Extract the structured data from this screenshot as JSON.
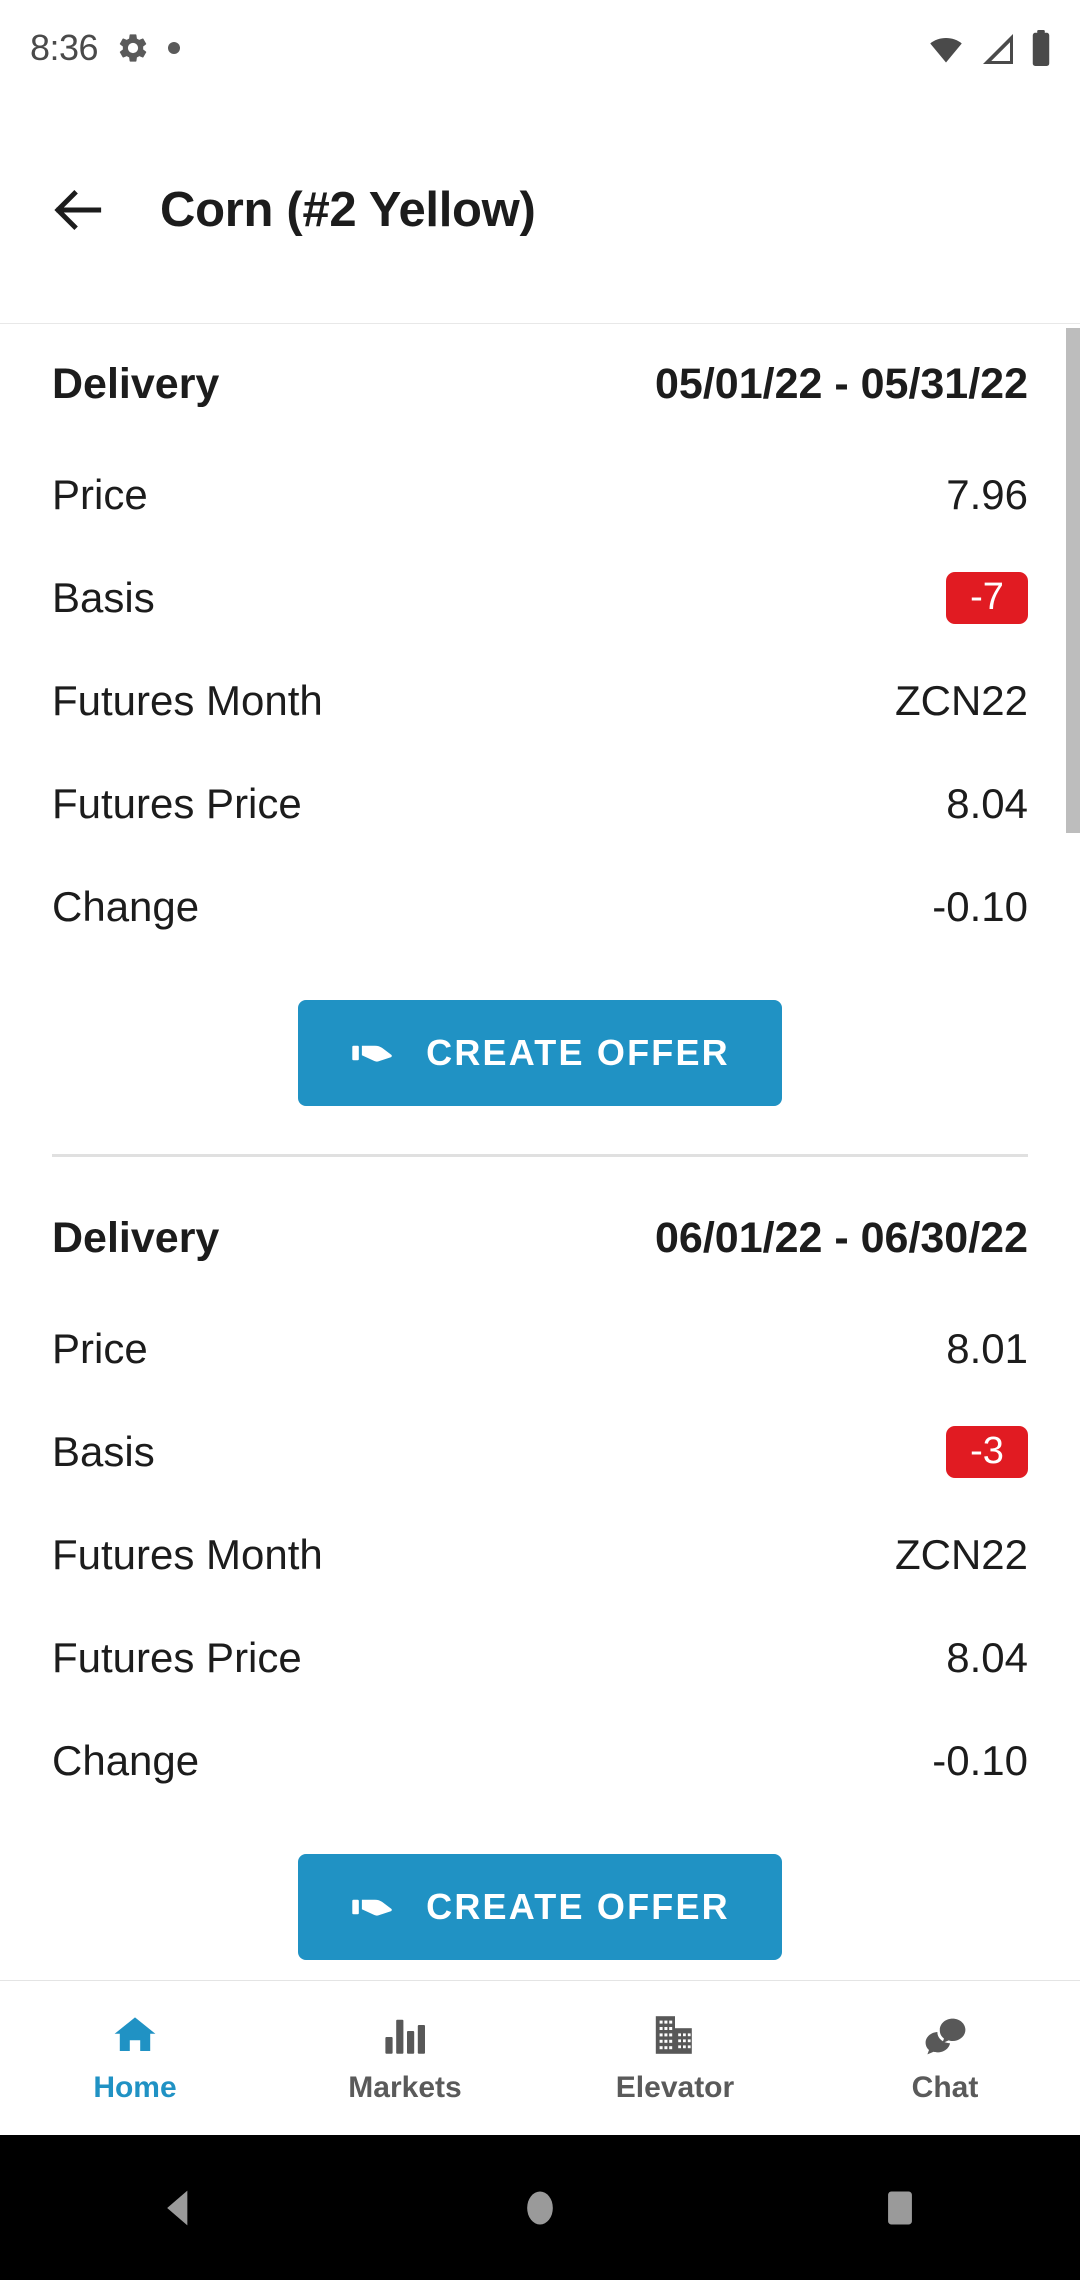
{
  "status_bar": {
    "time": "8:36",
    "icons_left": [
      "gear-icon",
      "dot-indicator"
    ],
    "icons_right": [
      "wifi-icon",
      "cellular-signal-icon",
      "battery-icon"
    ]
  },
  "app_bar": {
    "back_icon": "back-arrow-icon",
    "title": "Corn (#2 Yellow)"
  },
  "colors": {
    "accent": "#2092c4",
    "negative_badge": "#e11b22",
    "text": "#1c1c1c",
    "muted": "#5a5a5a"
  },
  "cards": [
    {
      "delivery_label": "Delivery",
      "delivery_range": "05/01/22 - 05/31/22",
      "rows": [
        {
          "label": "Price",
          "value": "7.96",
          "badge": false
        },
        {
          "label": "Basis",
          "value": "-7",
          "badge": true
        },
        {
          "label": "Futures Month",
          "value": "ZCN22",
          "badge": false
        },
        {
          "label": "Futures Price",
          "value": "8.04",
          "badge": false
        },
        {
          "label": "Change",
          "value": "-0.10",
          "badge": false
        }
      ],
      "button_label": "CREATE OFFER",
      "button_icon": "handshake-icon"
    },
    {
      "delivery_label": "Delivery",
      "delivery_range": "06/01/22 - 06/30/22",
      "rows": [
        {
          "label": "Price",
          "value": "8.01",
          "badge": false
        },
        {
          "label": "Basis",
          "value": "-3",
          "badge": true
        },
        {
          "label": "Futures Month",
          "value": "ZCN22",
          "badge": false
        },
        {
          "label": "Futures Price",
          "value": "8.04",
          "badge": false
        },
        {
          "label": "Change",
          "value": "-0.10",
          "badge": false
        }
      ],
      "button_label": "CREATE OFFER",
      "button_icon": "handshake-icon"
    }
  ],
  "bottom_nav": {
    "items": [
      {
        "label": "Home",
        "icon": "home-icon",
        "active": true
      },
      {
        "label": "Markets",
        "icon": "bar-chart-icon",
        "active": false
      },
      {
        "label": "Elevator",
        "icon": "building-icon",
        "active": false
      },
      {
        "label": "Chat",
        "icon": "chat-bubbles-icon",
        "active": false
      }
    ]
  },
  "system_nav": {
    "back": "back-triangle-icon",
    "home": "home-circle-icon",
    "recents": "recents-square-icon"
  }
}
